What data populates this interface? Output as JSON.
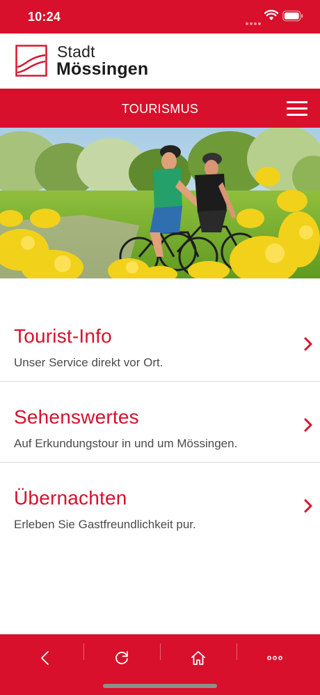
{
  "status_bar": {
    "time": "10:24",
    "signal_icon": "signal-dots-icon",
    "wifi_icon": "wifi-icon",
    "battery_icon": "battery-icon"
  },
  "brand": {
    "line1": "Stadt",
    "line2": "Mössingen",
    "logo_icon": "city-logo-icon"
  },
  "nav": {
    "title": "TOURISMUS",
    "menu_icon": "hamburger-menu-icon"
  },
  "hero": {
    "description_icon": "cyclists-photo"
  },
  "items": [
    {
      "title": "Tourist-Info",
      "subtitle": "Unser Service direkt vor Ort."
    },
    {
      "title": "Sehenswertes",
      "subtitle": "Auf Erkundungstour in und um Mössingen."
    },
    {
      "title": "Übernachten",
      "subtitle": "Erleben Sie Gastfreundlichkeit pur."
    }
  ],
  "toolbar": {
    "back_icon": "back-chevron-icon",
    "reload_icon": "reload-icon",
    "home_icon": "home-icon",
    "more_icon": "more-dots-icon"
  },
  "colors": {
    "brand_red": "#d8102b",
    "text_gray": "#4a4a4a",
    "divider": "#d9d9d9"
  }
}
